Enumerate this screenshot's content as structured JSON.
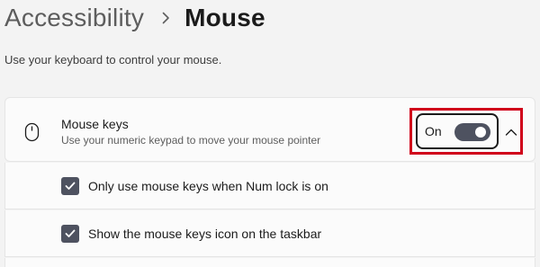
{
  "breadcrumb": {
    "parent": "Accessibility",
    "current": "Mouse"
  },
  "description": "Use your keyboard to control your mouse.",
  "mouse_keys": {
    "title": "Mouse keys",
    "subtitle": "Use your numeric keypad to move your mouse pointer",
    "icon": "mouse-icon",
    "toggle_label": "On",
    "toggle_state": true
  },
  "options": [
    {
      "label": "Only use mouse keys when Num lock is on",
      "checked": true
    },
    {
      "label": "Show the mouse keys icon on the taskbar",
      "checked": true
    }
  ],
  "colors": {
    "accent": "#4e5260",
    "highlight": "#d0021b",
    "background": "#f3f3f3",
    "card": "#fbfbfb"
  }
}
